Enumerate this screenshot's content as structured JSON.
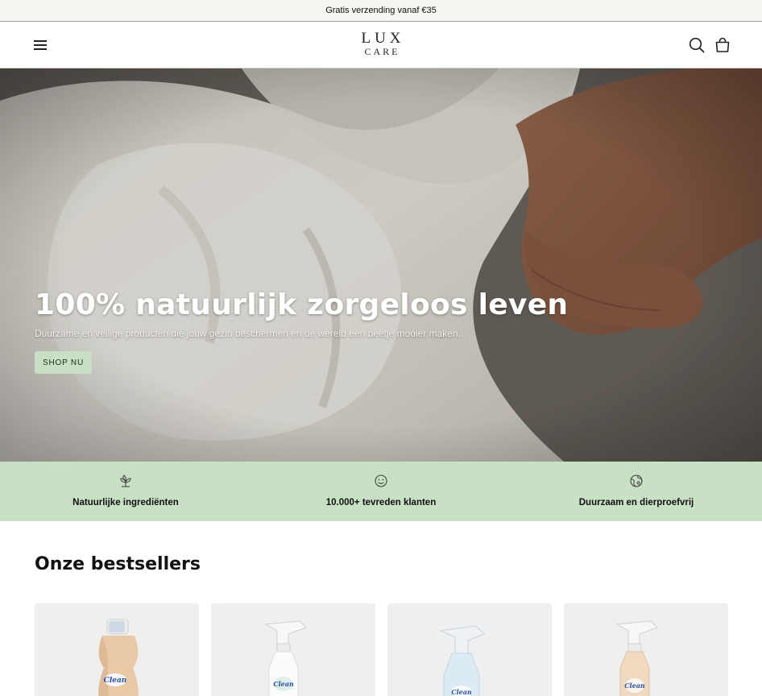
{
  "announcement": {
    "text": "Gratis verzending vanaf €35"
  },
  "header": {
    "logo_line1": "LUX",
    "logo_line2": "CARE",
    "menu_icon": "hamburger-menu-icon",
    "search_icon": "search-icon",
    "cart_icon": "shopping-bag-icon"
  },
  "hero": {
    "title": "100% natuurlijk zorgeloos leven",
    "subtitle": "Duurzame en veilige producten die jouw gezin beschermen en de wereld een beetje mooier maken.",
    "button_label": "SHOP NU"
  },
  "usps": [
    {
      "icon": "leaf-plant-icon",
      "label": "Natuurlijke ingrediënten"
    },
    {
      "icon": "smiley-face-icon",
      "label": "10.000+ tevreden klanten"
    },
    {
      "icon": "globe-leaf-icon",
      "label": "Duurzaam en dierproefvrij"
    }
  ],
  "bestsellers": {
    "title": "Onze bestsellers",
    "product_label": "Clean",
    "products": [
      {
        "image": "softener-bottle-image"
      },
      {
        "image": "white-spray-bottle-image"
      },
      {
        "image": "blue-spray-bottle-image"
      },
      {
        "image": "beige-spray-bottle-image"
      }
    ]
  },
  "colors": {
    "announcement_bg": "#f7f5f1",
    "usp_bg": "#c8e0c4",
    "button_bg": "#c9dfc3",
    "card_bg": "#efefef"
  }
}
